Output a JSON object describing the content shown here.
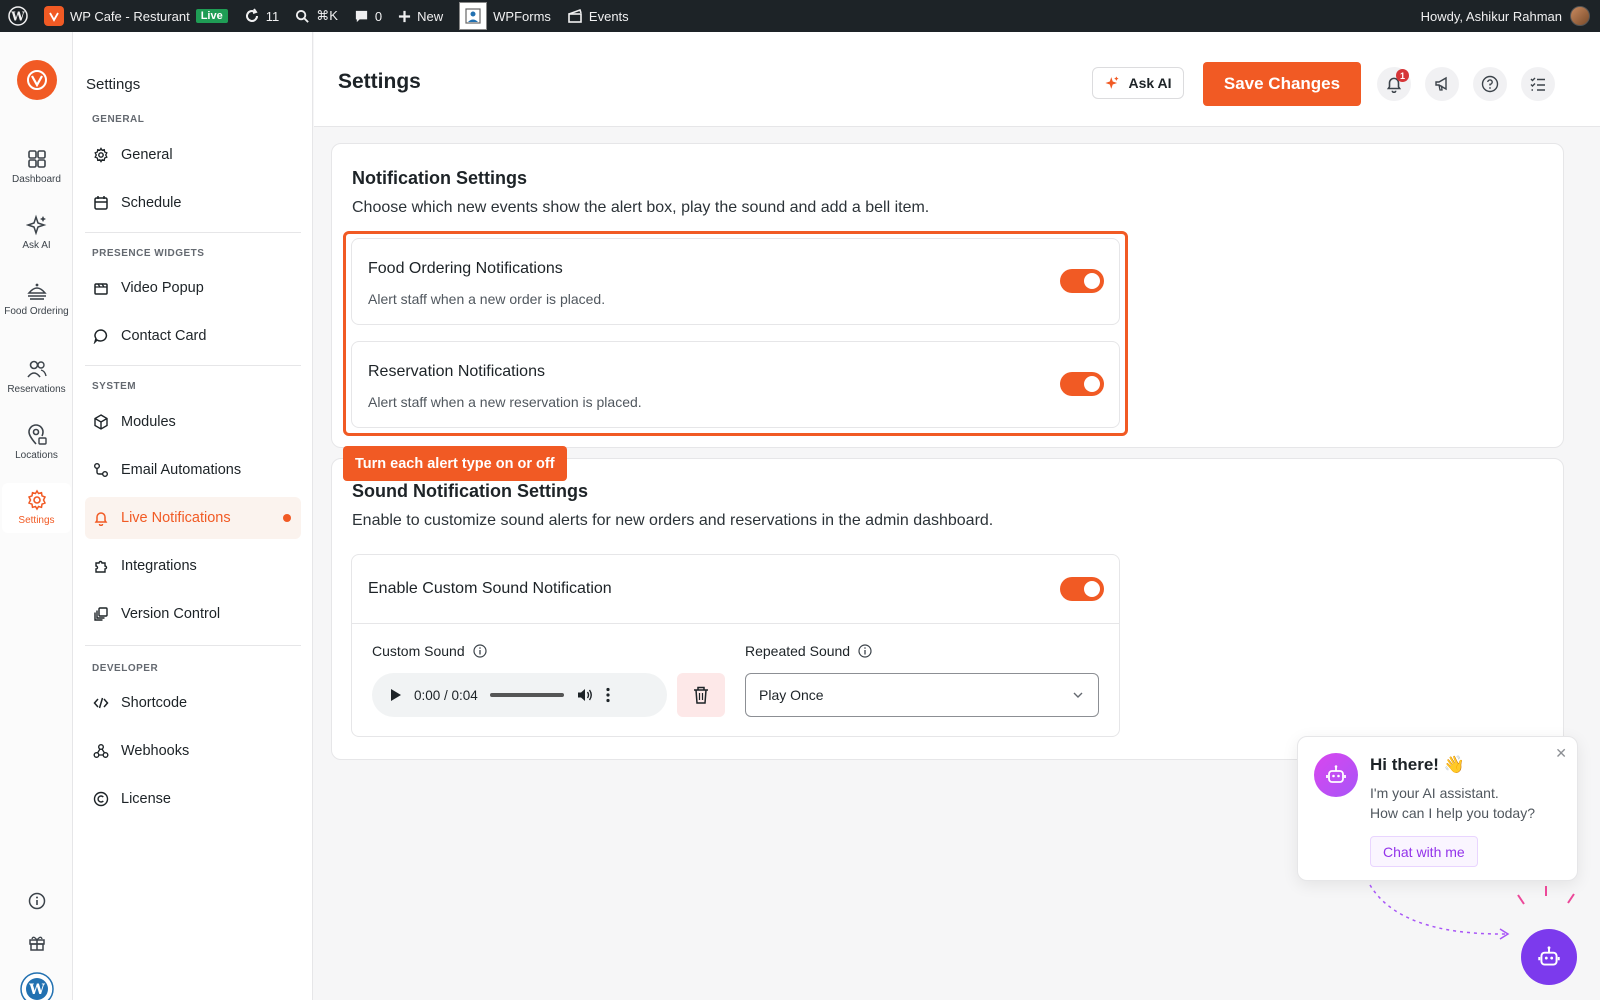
{
  "adminbar": {
    "site_name": "WP Cafe - Resturant",
    "live_badge": "Live",
    "updates_count": "11",
    "search_shortcut": "⌘K",
    "comments_count": "0",
    "new_label": "New",
    "wpforms_label": "WPForms",
    "events_label": "Events",
    "greeting": "Howdy, Ashikur Rahman"
  },
  "rail": {
    "items": [
      {
        "label": "Dashboard",
        "icon": "dashboard-icon"
      },
      {
        "label": "Ask AI",
        "icon": "sparkle-icon"
      },
      {
        "label": "Food Ordering",
        "icon": "food-icon"
      },
      {
        "label": "Reservations",
        "icon": "users-icon"
      },
      {
        "label": "Locations",
        "icon": "location-icon"
      },
      {
        "label": "Settings",
        "icon": "gear-icon",
        "active": true
      }
    ]
  },
  "menu": {
    "title": "Settings",
    "groups": [
      {
        "label": "GENERAL",
        "items": [
          {
            "label": "General",
            "icon": "gear-icon"
          },
          {
            "label": "Schedule",
            "icon": "calendar-icon"
          }
        ]
      },
      {
        "label": "PRESENCE WIDGETS",
        "items": [
          {
            "label": "Video Popup",
            "icon": "video-icon"
          },
          {
            "label": "Contact Card",
            "icon": "chat-bubble-icon"
          }
        ]
      },
      {
        "label": "SYSTEM",
        "items": [
          {
            "label": "Modules",
            "icon": "cube-icon"
          },
          {
            "label": "Email Automations",
            "icon": "automation-icon"
          },
          {
            "label": "Live Notifications",
            "icon": "bell-icon",
            "active": true
          },
          {
            "label": "Integrations",
            "icon": "puzzle-icon"
          },
          {
            "label": "Version Control",
            "icon": "layers-icon"
          }
        ]
      },
      {
        "label": "DEVELOPER",
        "items": [
          {
            "label": "Shortcode",
            "icon": "code-icon"
          },
          {
            "label": "Webhooks",
            "icon": "webhook-icon"
          },
          {
            "label": "License",
            "icon": "copyright-icon"
          }
        ]
      }
    ]
  },
  "header": {
    "title": "Settings",
    "ask_ai": "Ask AI",
    "save": "Save Changes",
    "notification_count": "1"
  },
  "notification_settings": {
    "title": "Notification Settings",
    "subtitle": "Choose which new events show the alert box, play the sound and add a bell item.",
    "rows": [
      {
        "title": "Food Ordering Notifications",
        "desc": "Alert staff when a new order is placed.",
        "enabled": true
      },
      {
        "title": "Reservation Notifications",
        "desc": "Alert staff when a new reservation is placed.",
        "enabled": true
      }
    ],
    "tooltip": "Turn each alert type on or off"
  },
  "sound_settings": {
    "title": "Sound Notification Settings",
    "subtitle": "Enable to customize sound alerts for new orders and reservations in the admin dashboard.",
    "enable_label": "Enable Custom Sound Notification",
    "enabled": true,
    "custom_sound_label": "Custom Sound",
    "audio_time": "0:00 / 0:04",
    "repeated_sound_label": "Repeated Sound",
    "repeated_sound_value": "Play Once"
  },
  "chat": {
    "title": "Hi there! 👋",
    "line1": "I'm your AI assistant.",
    "line2": "How can I help you today?",
    "button": "Chat with me"
  },
  "colors": {
    "accent": "#f15a24",
    "chat_accent": "#7c3aed"
  }
}
